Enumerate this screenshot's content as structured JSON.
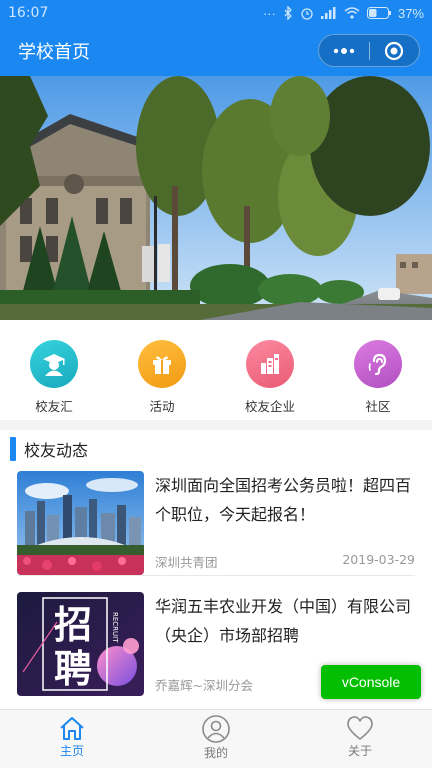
{
  "status_bar": {
    "time": "16:07",
    "battery": "37%"
  },
  "nav": {
    "title": "学校首页"
  },
  "menu": [
    {
      "label": "校友汇",
      "icon": "graduate-icon",
      "color": "#2cc3cf"
    },
    {
      "label": "活动",
      "icon": "gift-box-icon",
      "color": "#f5a623"
    },
    {
      "label": "校友企业",
      "icon": "buildings-icon",
      "color": "#f06f86"
    },
    {
      "label": "社区",
      "icon": "ear-icon",
      "color": "#c85fd0"
    }
  ],
  "section": {
    "title": "校友动态"
  },
  "news": [
    {
      "title": "深圳面向全国招考公务员啦！超四百个职位，今天起报名！",
      "source": "深圳共青团",
      "date": "2019-03-29",
      "thumb": "city-skyline-image"
    },
    {
      "title": "华润五丰农业开发（中国）有限公司（央企）市场部招聘",
      "source": "乔嘉辉~深圳分会",
      "date": "",
      "thumb": "recruit-poster-image",
      "thumb_text": [
        "招",
        "聘"
      ],
      "thumb_side_text": "RECRUIT"
    }
  ],
  "vconsole": {
    "label": "vConsole"
  },
  "tabs": [
    {
      "label": "主页",
      "icon": "home-icon",
      "active": true
    },
    {
      "label": "我的",
      "icon": "user-icon",
      "active": false
    },
    {
      "label": "关于",
      "icon": "heart-icon",
      "active": false
    }
  ],
  "colors": {
    "primary": "#1a88f0",
    "vconsole": "#04be02"
  }
}
